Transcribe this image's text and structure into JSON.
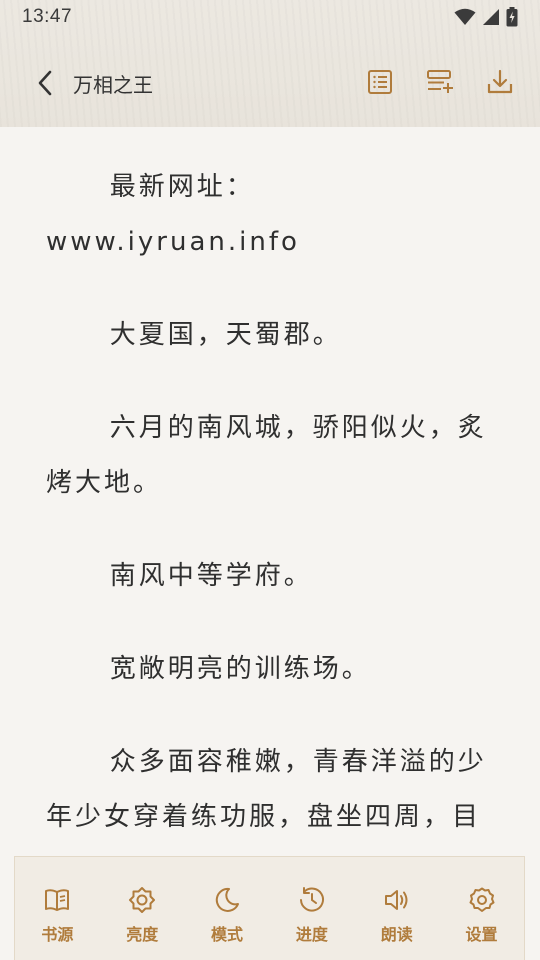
{
  "status": {
    "time": "13:47"
  },
  "header": {
    "title": "万相之王"
  },
  "content": {
    "paragraphs": [
      "最新网址：www.iyruan.info",
      "大夏国，天蜀郡。",
      "六月的南风城，骄阳似火，炙烤大地。",
      "南风中等学府。",
      "宽敞明亮的训练场。",
      "众多面容稚嫩，青春洋溢的少年少女穿着练功服，盘坐四周，目光望着场地中央，那里，有两道身"
    ]
  },
  "bottom_nav": {
    "items": [
      {
        "label": "书源",
        "icon": "book-source-icon"
      },
      {
        "label": "亮度",
        "icon": "brightness-icon"
      },
      {
        "label": "模式",
        "icon": "moon-icon"
      },
      {
        "label": "进度",
        "icon": "progress-icon"
      },
      {
        "label": "朗读",
        "icon": "speaker-icon"
      },
      {
        "label": "设置",
        "icon": "settings-icon"
      }
    ]
  },
  "colors": {
    "accent": "#b07c3c",
    "background": "#f6f4f1",
    "text": "#2f2f2f"
  }
}
